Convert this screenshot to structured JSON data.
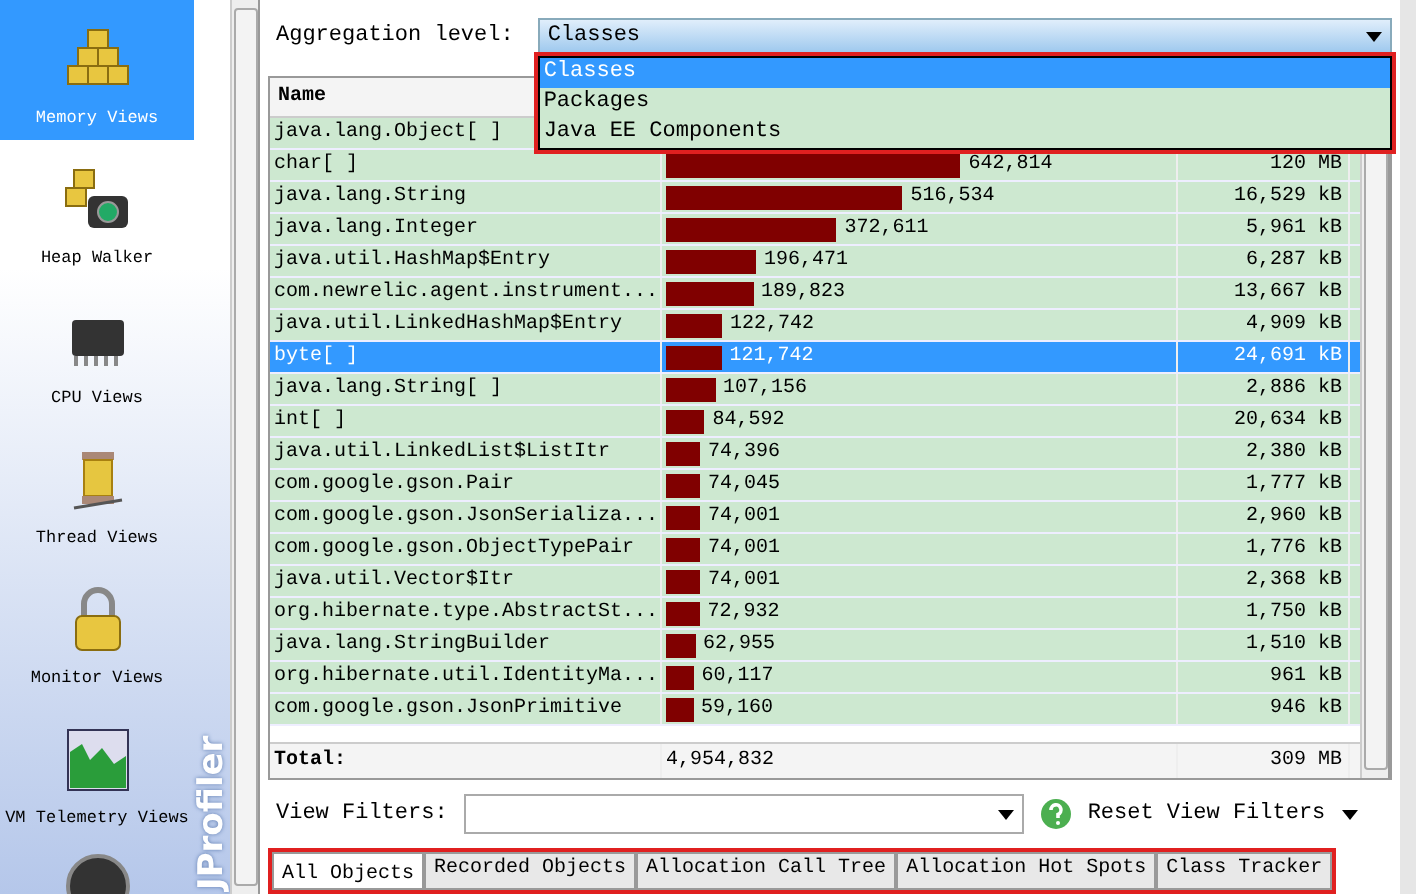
{
  "sidebar": {
    "items": [
      {
        "label": "Memory Views",
        "kind": "memory",
        "selected": true
      },
      {
        "label": "Heap Walker",
        "kind": "heap",
        "selected": false
      },
      {
        "label": "CPU Views",
        "kind": "cpu",
        "selected": false
      },
      {
        "label": "Thread Views",
        "kind": "thread",
        "selected": false
      },
      {
        "label": "Monitor Views",
        "kind": "monitor",
        "selected": false
      },
      {
        "label": "VM Telemetry Views",
        "kind": "telemetry",
        "selected": false
      },
      {
        "kind": "gauge",
        "selected": false
      }
    ],
    "logo": "JProfiler"
  },
  "aggregation": {
    "label": "Aggregation level:",
    "value": "Classes",
    "options": [
      {
        "label": "Classes",
        "selected": true
      },
      {
        "label": "Packages",
        "selected": false
      },
      {
        "label": "Java EE Components",
        "selected": false
      }
    ]
  },
  "table": {
    "columns": [
      "Name"
    ],
    "rows": [
      {
        "name": "java.lang.Object[ ]",
        "selected": false
      },
      {
        "name": "char[ ]",
        "count": "642,814",
        "level": 0.589,
        "size": "120 MB",
        "selected": false
      },
      {
        "name": "java.lang.String",
        "count": "516,534",
        "level": 0.473,
        "size": "16,529 kB",
        "selected": false
      },
      {
        "name": "java.lang.Integer",
        "count": "372,611",
        "level": 0.341,
        "size": "5,961 kB",
        "selected": false
      },
      {
        "name": "java.util.HashMap$Entry",
        "count": "196,471",
        "level": 0.18,
        "size": "6,287 kB",
        "selected": false
      },
      {
        "name": "com.newrelic.agent.instrument...",
        "count": "189,823",
        "level": 0.174,
        "size": "13,667 kB",
        "selected": false
      },
      {
        "name": "java.util.LinkedHashMap$Entry",
        "count": "122,742",
        "level": 0.112,
        "size": "4,909 kB",
        "selected": false
      },
      {
        "name": "byte[ ]",
        "count": "121,742",
        "level": 0.111,
        "size": "24,691 kB",
        "selected": true
      },
      {
        "name": "java.lang.String[ ]",
        "count": "107,156",
        "level": 0.098,
        "size": "2,886 kB",
        "selected": false
      },
      {
        "name": "int[ ]",
        "count": "84,592",
        "level": 0.077,
        "size": "20,634 kB",
        "selected": false
      },
      {
        "name": "java.util.LinkedList$ListItr",
        "count": "74,396",
        "level": 0.068,
        "size": "2,380 kB",
        "selected": false
      },
      {
        "name": "com.google.gson.Pair",
        "count": "74,045",
        "level": 0.068,
        "size": "1,777 kB",
        "selected": false
      },
      {
        "name": "com.google.gson.JsonSerializa...",
        "count": "74,001",
        "level": 0.068,
        "size": "2,960 kB",
        "selected": false
      },
      {
        "name": "com.google.gson.ObjectTypePair",
        "count": "74,001",
        "level": 0.068,
        "size": "1,776 kB",
        "selected": false
      },
      {
        "name": "java.util.Vector$Itr",
        "count": "74,001",
        "level": 0.068,
        "size": "2,368 kB",
        "selected": false
      },
      {
        "name": "org.hibernate.type.AbstractSt...",
        "count": "72,932",
        "level": 0.067,
        "size": "1,750 kB",
        "selected": false
      },
      {
        "name": "java.lang.StringBuilder",
        "count": "62,955",
        "level": 0.058,
        "size": "1,510 kB",
        "selected": false
      },
      {
        "name": "org.hibernate.util.IdentityMa...",
        "count": "60,117",
        "level": 0.055,
        "size": "961 kB",
        "selected": false
      },
      {
        "name": "com.google.gson.JsonPrimitive",
        "count": "59,160",
        "level": 0.054,
        "size": "946 kB",
        "selected": false
      }
    ],
    "total": {
      "label": "Total:",
      "count": "4,954,832",
      "size": "309 MB"
    }
  },
  "filters": {
    "label": "View Filters:",
    "reset": "Reset View Filters"
  },
  "tabs": [
    {
      "label": "All Objects",
      "selected": true
    },
    {
      "label": "Recorded Objects",
      "selected": false
    },
    {
      "label": "Allocation Call Tree",
      "selected": false
    },
    {
      "label": "Allocation Hot Spots",
      "selected": false
    },
    {
      "label": "Class Tracker",
      "selected": false
    }
  ]
}
